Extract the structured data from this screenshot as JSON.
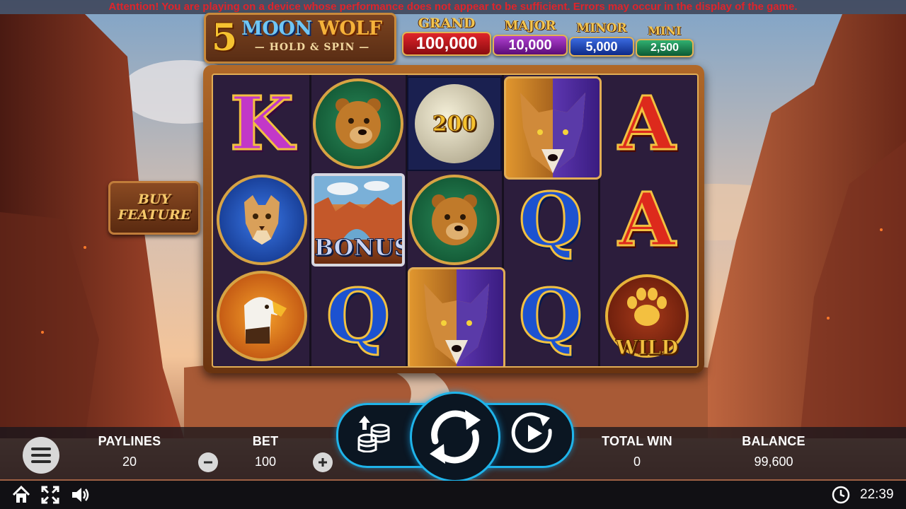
{
  "attention": "Attention! You are playing on a device whose performance does not appear to be sufficient. Errors may occur in the display of the game.",
  "logo": {
    "number": "5",
    "title_part1": "MOON",
    "title_part2": "WOLF",
    "subtitle": "HOLD & SPIN"
  },
  "jackpots": [
    {
      "name": "GRAND",
      "value": "100,000",
      "color": "#c8141c"
    },
    {
      "name": "MAJOR",
      "value": "10,000",
      "color": "#8a1ea8"
    },
    {
      "name": "MINOR",
      "value": "5,000",
      "color": "#1e46b8"
    },
    {
      "name": "MINI",
      "value": "2,500",
      "color": "#148a4c"
    }
  ],
  "buy_feature": {
    "line1": "BUY",
    "line2": "FEATURE"
  },
  "reels": {
    "symbols": [
      [
        "K",
        "cougar",
        "eagle"
      ],
      [
        "bear",
        "bonus",
        "Q"
      ],
      [
        "moon",
        "bear",
        "wolf"
      ],
      [
        "wolf",
        "Q",
        "Q"
      ],
      [
        "A",
        "A",
        "wild"
      ]
    ],
    "moon_value": "200",
    "bonus_label": "BONUS",
    "wild_label": "WILD"
  },
  "bottom": {
    "paylines_label": "PAYLINES",
    "paylines_value": "20",
    "bet_label": "BET",
    "bet_value": "100",
    "total_win_label": "TOTAL WIN",
    "total_win_value": "0",
    "balance_label": "BALANCE",
    "balance_value": "99,600"
  },
  "system": {
    "clock": "22:39"
  },
  "colors": {
    "accent": "#1fb4ea",
    "warning": "#e0242a",
    "gold": "#e2ad55"
  }
}
